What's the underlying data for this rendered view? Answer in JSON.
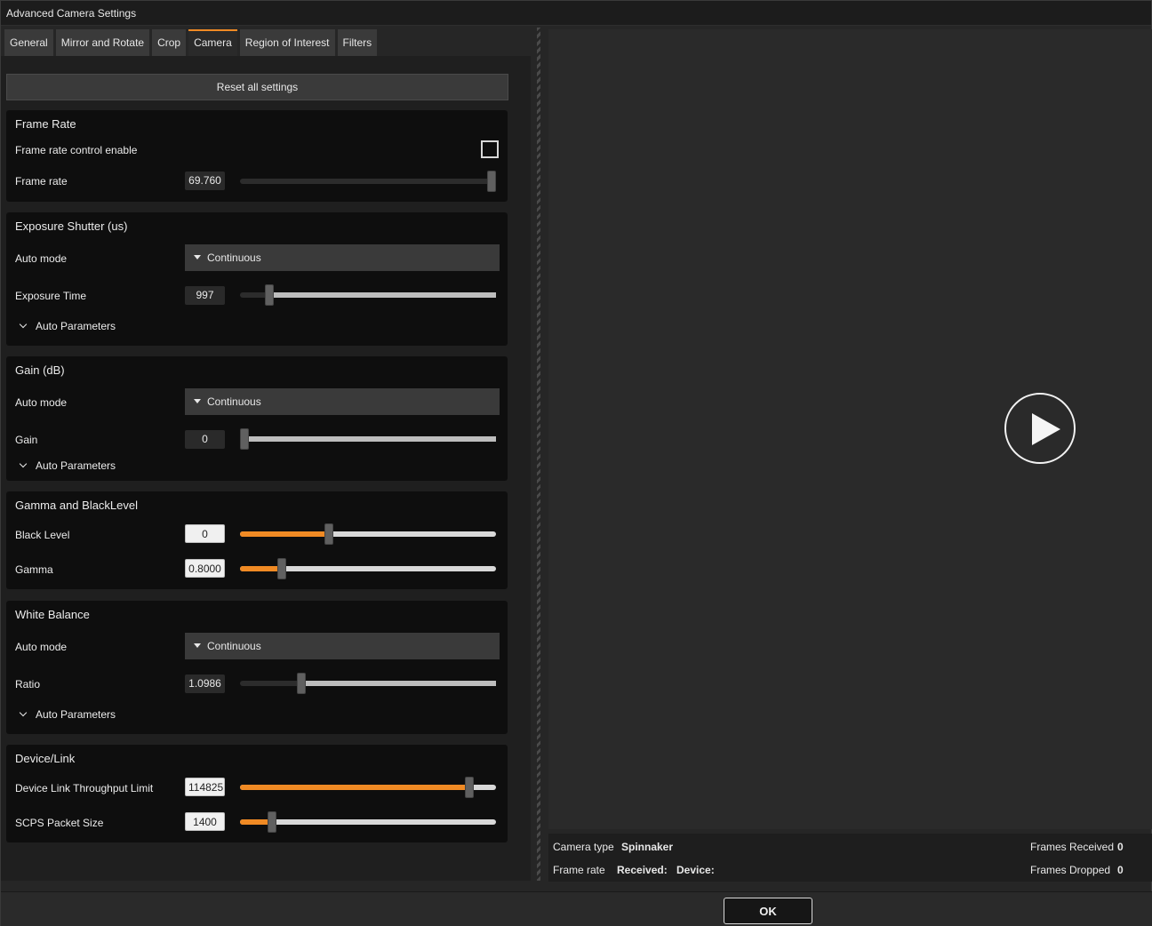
{
  "window": {
    "title": "Advanced Camera Settings"
  },
  "tabs": [
    {
      "label": "General"
    },
    {
      "label": "Mirror and Rotate"
    },
    {
      "label": "Crop"
    },
    {
      "label": "Camera",
      "active": true
    },
    {
      "label": "Region of Interest"
    },
    {
      "label": "Filters"
    }
  ],
  "reset_label": "Reset all settings",
  "frame_rate": {
    "heading": "Frame Rate",
    "enable_label": "Frame rate control enable",
    "enable_checked": false,
    "rate_label": "Frame rate",
    "rate_value": "69.760",
    "rate_slider": 1.0
  },
  "exposure": {
    "heading": "Exposure Shutter (us)",
    "auto_label": "Auto mode",
    "auto_value": "Continuous",
    "time_label": "Exposure Time",
    "time_value": "997",
    "time_slider": 0.1,
    "auto_params": "Auto Parameters"
  },
  "gain": {
    "heading": "Gain (dB)",
    "auto_label": "Auto mode",
    "auto_value": "Continuous",
    "gain_label": "Gain",
    "gain_value": "0",
    "gain_slider": 0.0,
    "auto_params": "Auto Parameters"
  },
  "gamma": {
    "heading": "Gamma and BlackLevel",
    "black_label": "Black Level",
    "black_value": "0",
    "black_slider": 0.34,
    "gamma_label": "Gamma",
    "gamma_value": "0.8000",
    "gamma_slider": 0.15
  },
  "white_balance": {
    "heading": "White Balance",
    "auto_label": "Auto mode",
    "auto_value": "Continuous",
    "ratio_label": "Ratio",
    "ratio_value": "1.0986",
    "ratio_slider": 0.23,
    "auto_params": "Auto Parameters"
  },
  "device_link": {
    "heading": "Device/Link",
    "throughput_label": "Device Link Throughput Limit",
    "throughput_value": "114825",
    "throughput_slider": 0.91,
    "packet_label": "SCPS Packet Size",
    "packet_value": "1400",
    "packet_slider": 0.11
  },
  "status": {
    "camera_type_label": "Camera type",
    "camera_type_value": "Spinnaker",
    "frame_rate_label": "Frame rate",
    "received_label": "Received:",
    "device_label": "Device:",
    "frames_received_label": "Frames Received",
    "frames_received_value": "0",
    "frames_dropped_label": "Frames Dropped",
    "frames_dropped_value": "0"
  },
  "ok_label": "OK",
  "colors": {
    "accent": "#f08a24",
    "panel": "#0e0e0e",
    "background": "#1f1f1f"
  },
  "icons": {
    "play": "play-icon",
    "chevron": "chevron-down-icon",
    "caret": "caret-down-icon"
  }
}
